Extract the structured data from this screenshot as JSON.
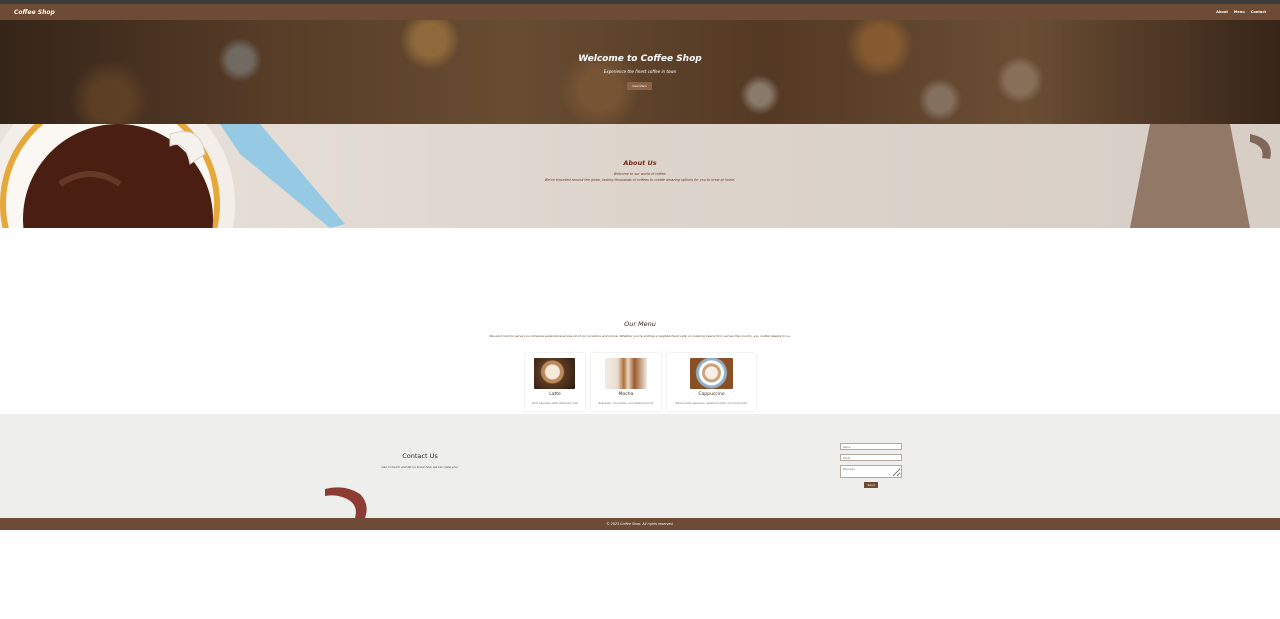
{
  "navbar": {
    "brand": "Coffee Shop",
    "links": [
      "About",
      "Menu",
      "Contact"
    ]
  },
  "hero": {
    "title": "Welcome to Coffee Shop",
    "subtitle": "Experience the finest coffee in town",
    "button_label": "View Menu"
  },
  "about": {
    "title": "About Us",
    "lines": [
      "Welcome to our world of coffee.",
      "We've travelled around the globe, tasting thousands of coffees to create amazing options for you to brew at home."
    ]
  },
  "menu": {
    "title": "Our Menu",
    "intro": "We work hard to serve you cohesive experience across all of our locations and online. Whether you're visiting a neighborhood cafe, or ordering beans from across the country, you matter deeply to us.",
    "items": [
      {
        "name": "Latte",
        "desc": "Rich espresso with steamed milk"
      },
      {
        "name": "Mocha",
        "desc": "Espresso, chocolate, and steamed milk"
      },
      {
        "name": "Cappuccino",
        "desc": "Equal parts espresso, steamed milk, and milk foam"
      }
    ]
  },
  "contact": {
    "title": "Contact Us",
    "text": "Get in touch and let us know how we can help you!",
    "name_placeholder": "Name",
    "email_placeholder": "Email",
    "message_placeholder": "Message",
    "send_label": "Send"
  },
  "footer": {
    "text": "© 2023 Coffee Shop. All rights reserved."
  },
  "colors": {
    "brand_brown": "#6e4b34",
    "accent_red": "#7a2a1c",
    "contact_bg": "#eeeeec"
  }
}
